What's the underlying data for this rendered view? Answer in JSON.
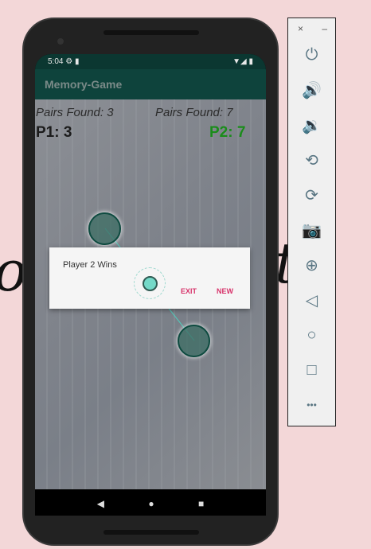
{
  "status_bar": {
    "time": "5:04",
    "icons": [
      "gear-icon",
      "sd-card-icon",
      "wifi-icon",
      "signal-icon",
      "battery-icon"
    ]
  },
  "app": {
    "title": "Memory-Game"
  },
  "scores": {
    "p1_pairs": "Pairs Found: 3",
    "p2_pairs": "Pairs Found: 7",
    "p1_score": "P1: 3",
    "p2_score": "P2: 7",
    "p2_color": "#1a8c1a"
  },
  "dialog": {
    "message": "Player 2 Wins",
    "exit_label": "EXIT",
    "new_label": "NEW",
    "accent": "#d8336b"
  },
  "nav": {
    "back": "◀",
    "home": "●",
    "recents": "■"
  },
  "emulator_panel": {
    "close": "×",
    "minimize": "–",
    "buttons": [
      {
        "name": "power",
        "glyph": "⏻"
      },
      {
        "name": "volume-up",
        "glyph": "🔊"
      },
      {
        "name": "volume-down",
        "glyph": "🔉"
      },
      {
        "name": "rotate-left",
        "glyph": "⟲"
      },
      {
        "name": "rotate-right",
        "glyph": "⟳"
      },
      {
        "name": "camera",
        "glyph": "📷"
      },
      {
        "name": "zoom",
        "glyph": "⊕"
      },
      {
        "name": "back",
        "glyph": "◁"
      },
      {
        "name": "home",
        "glyph": "○"
      },
      {
        "name": "overview",
        "glyph": "□"
      },
      {
        "name": "more",
        "glyph": "•••"
      }
    ]
  }
}
